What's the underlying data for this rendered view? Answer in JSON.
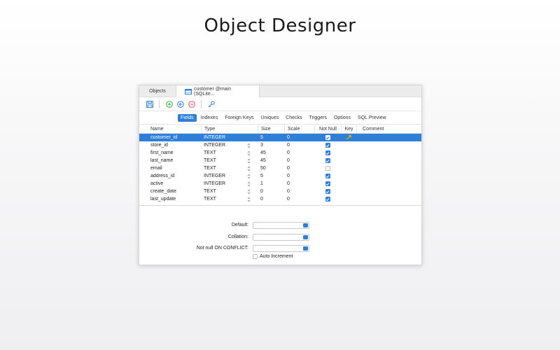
{
  "page": {
    "title": "Object Designer"
  },
  "tabs": [
    {
      "label": "Objects"
    },
    {
      "label": "customer @main (SQLite..."
    }
  ],
  "toolbar": {
    "buttons": [
      {
        "icon": "save-icon"
      },
      {
        "icon": "add-field-icon"
      },
      {
        "icon": "insert-field-icon"
      },
      {
        "icon": "delete-field-icon"
      },
      {
        "icon": "primary-key-icon"
      }
    ]
  },
  "subtabs": [
    "Fields",
    "Indexes",
    "Foreign Keys",
    "Uniques",
    "Checks",
    "Triggers",
    "Options",
    "SQL Preview"
  ],
  "columns": [
    "Name",
    "Type",
    "Size",
    "Scale",
    "Not Null",
    "Key",
    "Comment"
  ],
  "rows": [
    {
      "name": "customer_id",
      "type": "INTEGER",
      "size": "5",
      "scale": "0",
      "not_null": true,
      "key": true,
      "selected": true
    },
    {
      "name": "store_id",
      "type": "INTEGER",
      "size": "3",
      "scale": "0",
      "not_null": true,
      "key": false
    },
    {
      "name": "first_name",
      "type": "TEXT",
      "size": "45",
      "scale": "0",
      "not_null": true,
      "key": false
    },
    {
      "name": "last_name",
      "type": "TEXT",
      "size": "45",
      "scale": "0",
      "not_null": true,
      "key": false
    },
    {
      "name": "email",
      "type": "TEXT",
      "size": "50",
      "scale": "0",
      "not_null": false,
      "key": false
    },
    {
      "name": "address_id",
      "type": "INTEGER",
      "size": "5",
      "scale": "0",
      "not_null": true,
      "key": false
    },
    {
      "name": "active",
      "type": "INTEGER",
      "size": "1",
      "scale": "0",
      "not_null": true,
      "key": false
    },
    {
      "name": "create_date",
      "type": "TEXT",
      "size": "0",
      "scale": "0",
      "not_null": true,
      "key": false
    },
    {
      "name": "last_update",
      "type": "TEXT",
      "size": "0",
      "scale": "0",
      "not_null": true,
      "key": false
    }
  ],
  "properties": {
    "default_label": "Default:",
    "collation_label": "Collation:",
    "on_conflict_label": "Not null ON CONFLICT:",
    "auto_increment_label": "Auto Increment",
    "auto_increment_checked": false
  },
  "colors": {
    "accent": "#2f7fd8",
    "add": "#3cab3c",
    "insert": "#2f7fd8",
    "delete": "#e0524a",
    "key": "#d9a321"
  }
}
